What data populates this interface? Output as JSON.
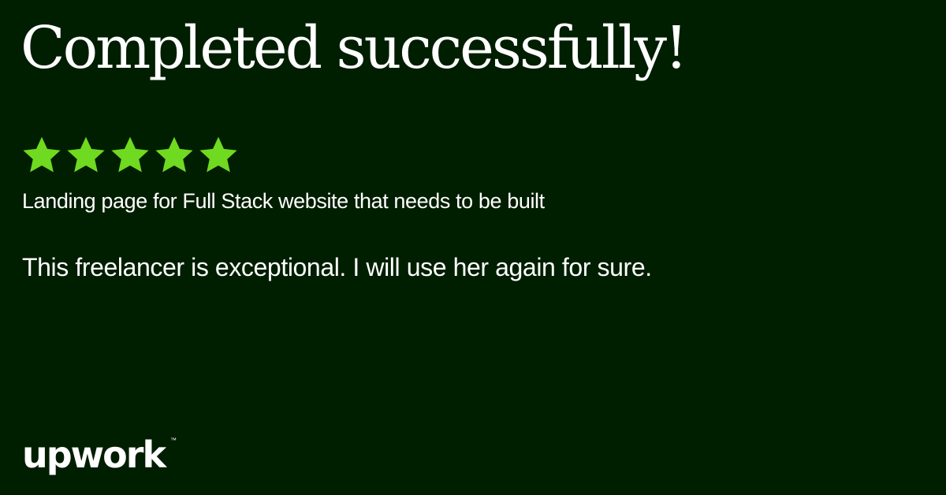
{
  "headline": "Completed successfully!",
  "rating": {
    "stars_filled": 5,
    "stars_total": 5,
    "star_icon": "star-icon",
    "star_color": "#6fda20"
  },
  "project_title": "Landing page for Full Stack website that needs to be built",
  "review_text": "This freelancer is exceptional.  I will use her again for sure.",
  "brand": {
    "logo_text": "upwork",
    "trademark": "™",
    "background_color": "#001e00",
    "text_color": "#ffffff"
  }
}
